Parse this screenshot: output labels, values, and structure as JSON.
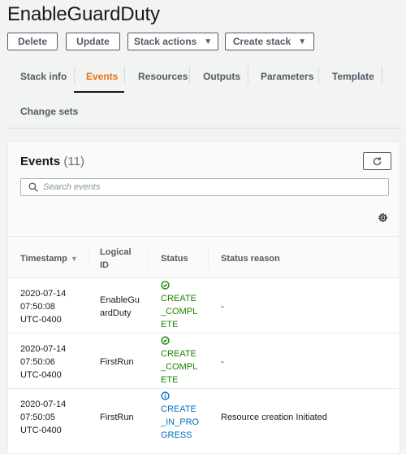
{
  "page_title": "EnableGuardDuty",
  "actions": {
    "delete": "Delete",
    "update": "Update",
    "stack_actions": "Stack actions",
    "create_stack": "Create stack"
  },
  "tabs": [
    {
      "label": "Stack info",
      "active": false
    },
    {
      "label": "Events",
      "active": true
    },
    {
      "label": "Resources",
      "active": false
    },
    {
      "label": "Outputs",
      "active": false
    },
    {
      "label": "Parameters",
      "active": false
    },
    {
      "label": "Template",
      "active": false
    },
    {
      "label": "Change sets",
      "active": false
    }
  ],
  "events_panel": {
    "title": "Events",
    "count": "(11)",
    "search_placeholder": "Search events",
    "search_value": ""
  },
  "table": {
    "columns": [
      "Timestamp",
      "Logical ID",
      "Status",
      "Status reason"
    ],
    "sorted_column": "Timestamp",
    "rows": [
      {
        "timestamp": [
          "2020-07-14",
          "07:50:08",
          "UTC-0400"
        ],
        "logical_id": "EnableGuardDuty",
        "status": "CREATE_COMPLETE",
        "status_type": "success",
        "status_reason": "-"
      },
      {
        "timestamp": [
          "2020-07-14",
          "07:50:06",
          "UTC-0400"
        ],
        "logical_id": "FirstRun",
        "status": "CREATE_COMPLETE",
        "status_type": "success",
        "status_reason": "-"
      },
      {
        "timestamp": [
          "2020-07-14",
          "07:50:05",
          "UTC-0400"
        ],
        "logical_id": "FirstRun",
        "status": "CREATE_IN_PROGRESS",
        "status_type": "info",
        "status_reason": "Resource creation Initiated"
      }
    ]
  },
  "colors": {
    "accent_active_tab": "#ec7211",
    "success": "#1d8102",
    "info": "#0073bb"
  }
}
